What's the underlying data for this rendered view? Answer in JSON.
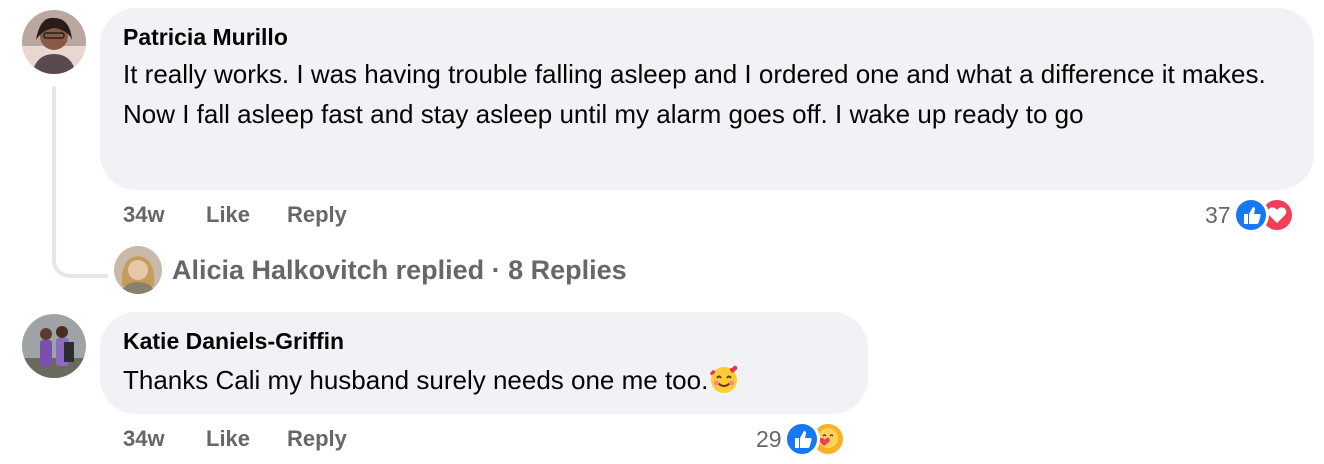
{
  "comments": [
    {
      "author": "Patricia Murillo",
      "text": "It really works. I was having trouble falling asleep and I ordered one and what a difference it makes. Now I fall asleep fast and stay asleep until my alarm goes off. I wake up ready to go",
      "time": "34w",
      "like_label": "Like",
      "reply_label": "Reply",
      "reaction_count": "37",
      "reactions": [
        "like-icon",
        "love-icon"
      ],
      "replies": {
        "summary": "Alicia Halkovitch replied · 8 Replies"
      }
    },
    {
      "author": "Katie Daniels-Griffin",
      "text": "Thanks Cali my husband surely needs one me too.",
      "text_emoji": "smiling-face-with-hearts-icon",
      "time": "34w",
      "like_label": "Like",
      "reply_label": "Reply",
      "reaction_count": "29",
      "reactions": [
        "like-icon",
        "care-icon"
      ]
    }
  ],
  "colors": {
    "bubble": "#f0f2f5",
    "meta": "#65676b",
    "like": "#1877f2",
    "love": "#f33e58",
    "care": "#f7b125"
  }
}
